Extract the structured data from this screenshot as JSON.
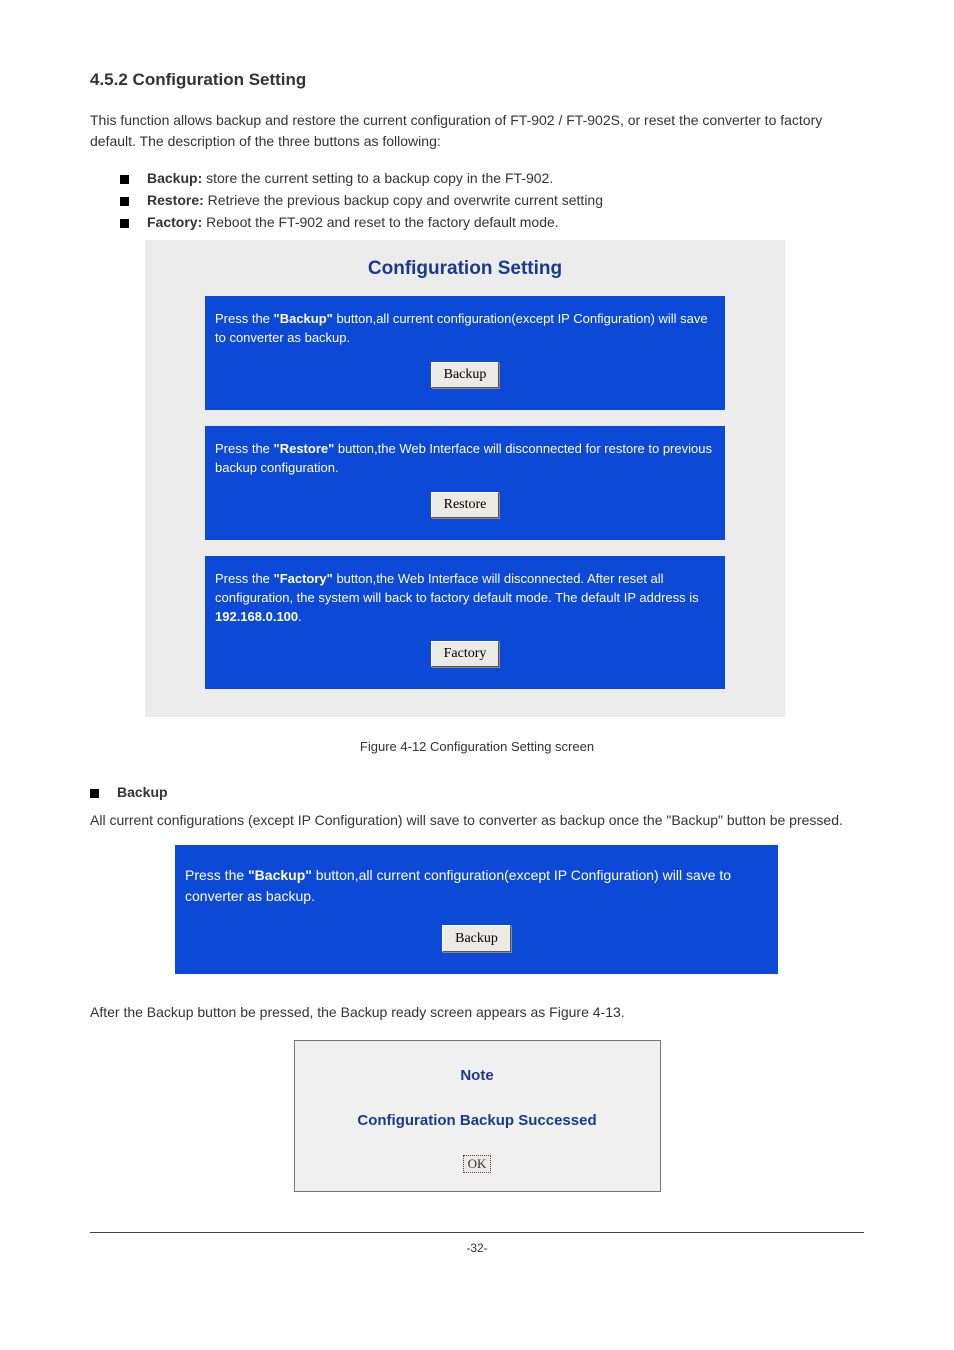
{
  "section": {
    "number": "4.5.2",
    "title": "Configuration Setting"
  },
  "intro": "This function allows backup and restore the current configuration of FT-902 / FT-902S, or reset the converter to factory default. The description of the three buttons as following:",
  "bullets": [
    {
      "bold": "Backup:",
      "rest": " store the current setting to a backup copy in the FT-902."
    },
    {
      "bold": "Restore:",
      "rest": " Retrieve the previous backup copy and overwrite current setting"
    },
    {
      "bold": "Factory:",
      "rest": " Reboot the FT-902 and reset to the factory default mode."
    }
  ],
  "panel": {
    "title": "Configuration Setting",
    "blocks": [
      {
        "pre": "Press the ",
        "bold": "\"Backup\"",
        "post": " button,all current configuration(except IP Configuration) will save to converter as backup.",
        "button": "Backup"
      },
      {
        "pre": "Press the ",
        "bold": "\"Restore\"",
        "post": " button,the Web Interface will disconnected for restore to previous backup configuration.",
        "button": "Restore"
      },
      {
        "pre": "Press the ",
        "bold": "\"Factory\"",
        "post": " button,the Web Interface will disconnected. After reset all configuration, the system will back to factory default mode. The default IP address is ",
        "bold2": "192.168.0.100",
        "post2": ".",
        "button": "Factory"
      }
    ]
  },
  "figure_caption": "Figure 4-12 Configuration Setting screen",
  "backup_section": {
    "bullet_bold": "Backup",
    "text": "All current configurations (except IP Configuration) will save to converter as backup once the \"Backup\" button be pressed.",
    "block_pre": "Press the ",
    "block_bold": "\"Backup\"",
    "block_post": " button,all current configuration(except IP Configuration) will save to converter as backup.",
    "button": "Backup",
    "after": "After the Backup button be pressed, the Backup ready screen appears as Figure 4-13."
  },
  "note": {
    "title": "Note",
    "message": "Configuration Backup Successed",
    "ok": "OK"
  },
  "footer": "-32-"
}
